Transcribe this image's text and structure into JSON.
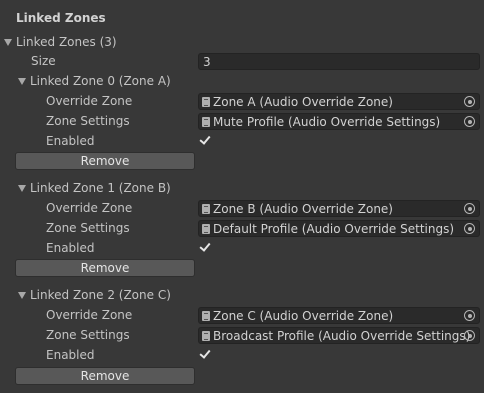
{
  "inspector": {
    "header": "Linked Zones",
    "list_label": "Linked Zones (3)",
    "size_label": "Size",
    "size_value": "3",
    "labels": {
      "override_zone": "Override Zone",
      "zone_settings": "Zone Settings",
      "enabled": "Enabled",
      "remove": "Remove"
    },
    "zones": [
      {
        "title": "Linked Zone 0 (Zone A)",
        "override_zone": "Zone A (Audio Override Zone)",
        "zone_settings": "Mute Profile (Audio Override Settings)",
        "enabled": true
      },
      {
        "title": "Linked Zone 1 (Zone B)",
        "override_zone": "Zone B (Audio Override Zone)",
        "zone_settings": "Default Profile (Audio Override Settings)",
        "enabled": true
      },
      {
        "title": "Linked Zone 2 (Zone C)",
        "override_zone": "Zone C (Audio Override Zone)",
        "zone_settings": "Broadcast Profile (Audio Override Settings)",
        "enabled": true
      }
    ]
  },
  "icons": {
    "foldout": "triangle-down-icon",
    "object": "document-icon",
    "picker": "object-picker-icon",
    "check": "checkmark-icon"
  },
  "colors": {
    "background": "#383838",
    "field": "#2a2a2a",
    "button": "#585858",
    "text": "#c4c4c4"
  }
}
